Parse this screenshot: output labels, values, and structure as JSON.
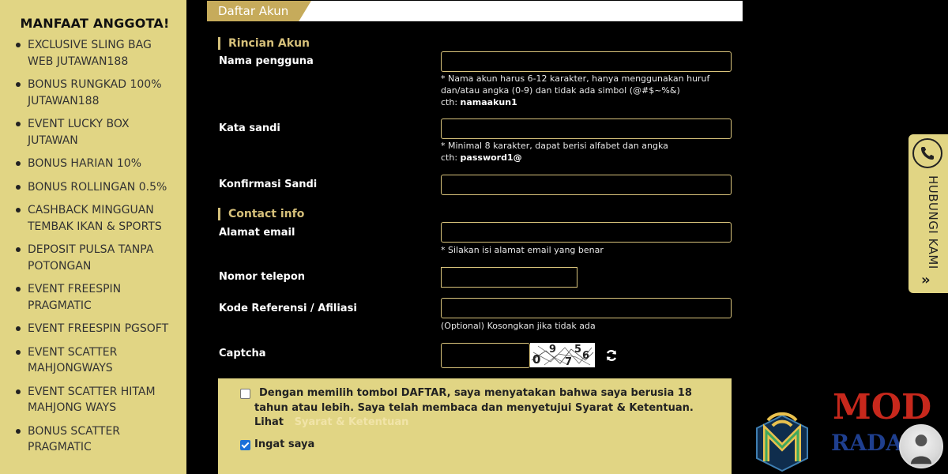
{
  "sidebar": {
    "title": "MANFAAT ANGGOTA!",
    "items": [
      "EXCLUSIVE SLING BAG WEB JUTAWAN188",
      "BONUS RUNGKAD 100% JUTAWAN188",
      "EVENT LUCKY BOX JUTAWAN",
      "BONUS HARIAN 10%",
      "BONUS ROLLINGAN 0.5%",
      "CASHBACK MINGGUAN TEMBAK IKAN & SPORTS",
      "DEPOSIT PULSA TANPA POTONGAN",
      "EVENT FREESPIN PRAGMATIC",
      "EVENT FREESPIN PGSOFT",
      "EVENT SCATTER MAHJONGWAYS",
      "EVENT SCATTER HITAM MAHJONG WAYS",
      "BONUS SCATTER PRAGMATIC"
    ]
  },
  "form": {
    "header": "Daftar Akun",
    "account_section": "Rincian Akun",
    "username": {
      "label": "Nama pengguna",
      "hint": "* Nama akun harus 6-12 karakter, hanya menggunakan huruf dan/atau angka (0-9) dan tidak ada simbol (@#$~%&)",
      "example_prefix": "cth:",
      "example": "namaakun1"
    },
    "password": {
      "label": "Kata sandi",
      "hint": "* Minimal 8 karakter, dapat berisi alfabet dan angka",
      "example_prefix": "cth:",
      "example": "password1@"
    },
    "confirm_password": {
      "label": "Konfirmasi Sandi"
    },
    "contact_section": "Contact info",
    "email": {
      "label": "Alamat email",
      "hint": "* Silakan isi alamat email yang benar"
    },
    "phone": {
      "label": "Nomor telepon"
    },
    "referral": {
      "label": "Kode Referensi / Afiliasi",
      "hint": "(Optional) Kosongkan jika tidak ada"
    },
    "captcha": {
      "label": "Captcha",
      "code": "09756"
    }
  },
  "terms": {
    "text": "Dengan memilih tombol DAFTAR, saya menyatakan bahwa saya berusia 18 tahun atau lebih. Saya telah membaca dan menyetujui Syarat & Ketentuan. Lihat",
    "link_text": "Syarat & Ketentuan",
    "agree_checked": false,
    "remember_label": "Ingat saya",
    "remember_checked": true
  },
  "contact_tab": {
    "label": "HUBUNGI KAMI",
    "arrow": "»",
    "icon": "phone-icon"
  },
  "watermark": {
    "line1": "MOD",
    "line2": "RADAR"
  },
  "colors": {
    "gold": "#e1d584",
    "accent": "#c6ab5b",
    "background": "#000000",
    "watermark_red": "#c7281c",
    "watermark_blue": "#1f3f8f"
  }
}
